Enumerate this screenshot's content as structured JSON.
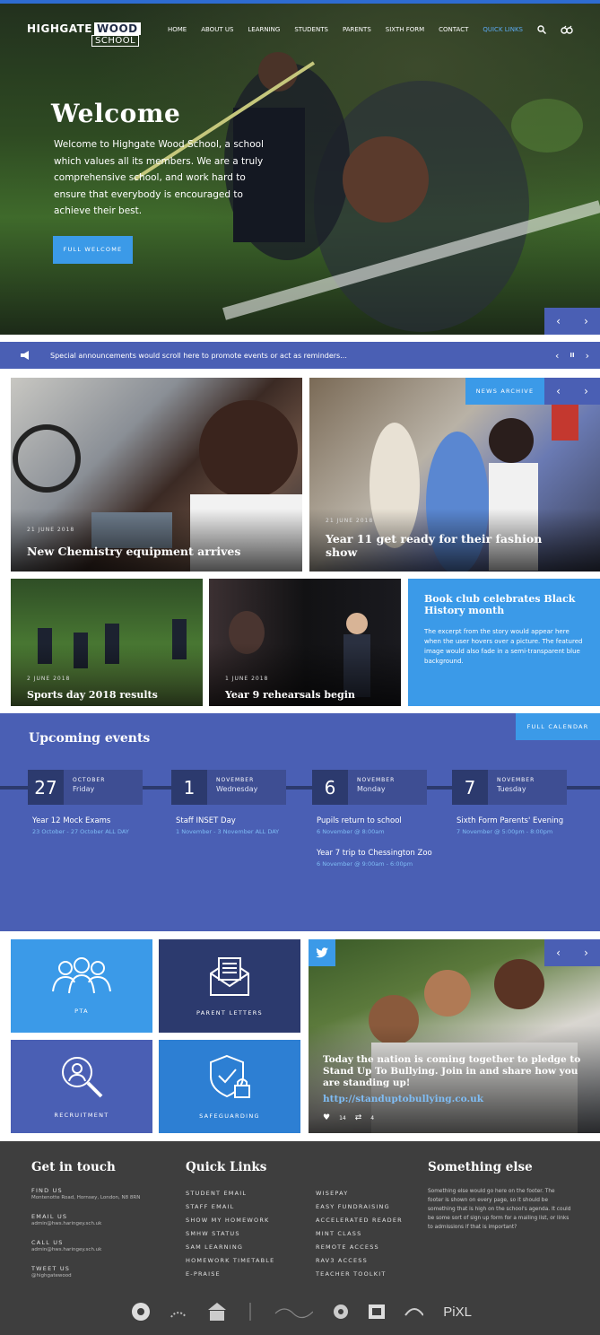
{
  "header": {
    "logo_word1": "HIGHGATE",
    "logo_word2": "WOOD",
    "logo_word3": "SCHOOL",
    "nav": [
      "HOME",
      "ABOUT US",
      "LEARNING",
      "STUDENTS",
      "PARENTS",
      "SIXTH FORM",
      "CONTACT",
      "QUICK LINKS"
    ],
    "active_nav": "QUICK LINKS"
  },
  "hero": {
    "title": "Welcome",
    "text": "Welcome to Highgate Wood School, a school which values all its members. We are a truly comprehensive school, and work hard to ensure that everybody is encouraged to achieve their best.",
    "button": "FULL WELCOME",
    "prev": "‹",
    "next": "›"
  },
  "announcement": {
    "text": "Special announcements would scroll here to promote events or act as reminders...",
    "prev": "‹",
    "pause": "II",
    "next": "›"
  },
  "news": {
    "archive_label": "NEWS ARCHIVE",
    "items": [
      {
        "date": "21 JUNE 2018",
        "title": "New Chemistry equipment arrives"
      },
      {
        "date": "21 JUNE 2018",
        "title": "Year 11 get ready for their fashion show"
      },
      {
        "date": "2 JUNE 2018",
        "title": "Sports day 2018 results"
      },
      {
        "date": "1 JUNE 2018",
        "title": "Year 9 rehearsals begin"
      },
      {
        "title": "Book club celebrates Black History month",
        "excerpt": "The excerpt from the story would appear here when the user hovers over a picture. The featured image would also fade in a semi-transparent blue background."
      }
    ]
  },
  "events": {
    "heading": "Upcoming events",
    "calendar_label": "FULL CALENDAR",
    "items": [
      {
        "day": "27",
        "month": "OCTOBER",
        "weekday": "Friday",
        "entries": [
          {
            "title": "Year 12 Mock Exams",
            "sub": "23 October - 27 October ALL DAY"
          }
        ]
      },
      {
        "day": "1",
        "month": "NOVEMBER",
        "weekday": "Wednesday",
        "entries": [
          {
            "title": "Staff INSET Day",
            "sub": "1 November - 3 November ALL DAY"
          }
        ]
      },
      {
        "day": "6",
        "month": "NOVEMBER",
        "weekday": "Monday",
        "entries": [
          {
            "title": "Pupils return to school",
            "sub": "6 November @ 8:00am"
          },
          {
            "title": "Year 7 trip to Chessington Zoo",
            "sub": "6 November @ 9:00am - 6:00pm"
          }
        ]
      },
      {
        "day": "7",
        "month": "NOVEMBER",
        "weekday": "Tuesday",
        "entries": [
          {
            "title": "Sixth Form Parents' Evening",
            "sub": "7 November @ 5:00pm - 8:00pm"
          }
        ]
      }
    ]
  },
  "tiles": [
    {
      "label": "PTA",
      "icon": "people-icon",
      "color": "#3b9ae8"
    },
    {
      "label": "PARENT LETTERS",
      "icon": "envelope-icon",
      "color": "#2c3a6e"
    },
    {
      "label": "RECRUITMENT",
      "icon": "magnifier-person-icon",
      "color": "#4a5fb4"
    },
    {
      "label": "SAFEGUARDING",
      "icon": "shield-lock-icon",
      "color": "#2d7fd3"
    }
  ],
  "tweet": {
    "text": "Today the nation is coming together to pledge to Stand Up To Bullying. Join in and share how you are standing up!",
    "link": "http://standuptobullying.co.uk",
    "likes": "14",
    "retweets": "4"
  },
  "footer": {
    "contact_heading": "Get in touch",
    "contact": [
      {
        "label": "FIND US",
        "value": "Montenotte Road, Hornsey, London, N8 8RN"
      },
      {
        "label": "EMAIL US",
        "value": "admin@hws.haringey.sch.uk"
      },
      {
        "label": "CALL US",
        "value": "admin@hws.haringey.sch.uk"
      },
      {
        "label": "TWEET US",
        "value": "@highgatewood"
      }
    ],
    "links_heading": "Quick Links",
    "links_col1": [
      "STUDENT EMAIL",
      "STAFF EMAIL",
      "SHOW MY HOMEWORK",
      "SMHW STATUS",
      "SAM LEARNING",
      "HOMEWORK TIMETABLE",
      "E-PRAISE"
    ],
    "links_col2": [
      "WISEPAY",
      "EASY FUNDRAISING",
      "ACCELERATED READER",
      "MINT CLASS",
      "REMOTE ACCESS",
      "RAV3 ACCESS",
      "TEACHER TOOLKIT"
    ],
    "else_heading": "Something else",
    "else_text": "Something else would go here on the footer. The footer is shown on every page, so it should be something that is high on the school's agenda. It could be some sort of sign up form for a mailing list, or links to admissions if that is important?",
    "partner_logo_text": "PiXL"
  }
}
